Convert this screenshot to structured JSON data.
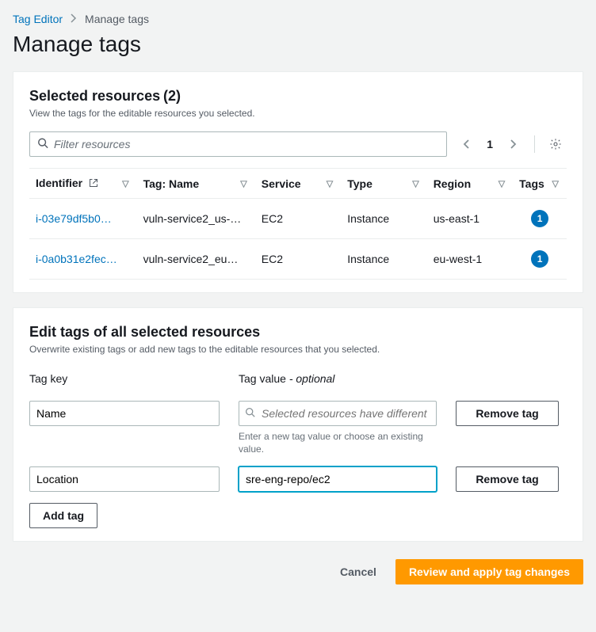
{
  "breadcrumb": {
    "root": "Tag Editor",
    "current": "Manage tags"
  },
  "page_title": "Manage tags",
  "selected_panel": {
    "title": "Selected resources",
    "count": "(2)",
    "subtitle": "View the tags for the editable resources you selected.",
    "filter_placeholder": "Filter resources",
    "page_number": "1",
    "columns": {
      "identifier": "Identifier",
      "tag_name": "Tag: Name",
      "service": "Service",
      "type": "Type",
      "region": "Region",
      "tags": "Tags"
    },
    "rows": [
      {
        "identifier": "i-03e79df5b0…",
        "tag_name": "vuln-service2_us-…",
        "service": "EC2",
        "type": "Instance",
        "region": "us-east-1",
        "tags": "1"
      },
      {
        "identifier": "i-0a0b31e2fec…",
        "tag_name": "vuln-service2_eu…",
        "service": "EC2",
        "type": "Instance",
        "region": "eu-west-1",
        "tags": "1"
      }
    ]
  },
  "edit_panel": {
    "title": "Edit tags of all selected resources",
    "subtitle": "Overwrite existing tags or add new tags to the editable resources that you selected.",
    "labels": {
      "tag_key": "Tag key",
      "tag_value": "Tag value",
      "optional": " - optional"
    },
    "value_placeholder": "Selected resources have different tag values",
    "value_help": "Enter a new tag value or choose an existing value.",
    "remove_tag": "Remove tag",
    "add_tag": "Add tag",
    "rows": [
      {
        "key": "Name",
        "value": ""
      },
      {
        "key": "Location",
        "value": "sre-eng-repo/ec2"
      }
    ]
  },
  "footer": {
    "cancel": "Cancel",
    "apply": "Review and apply tag changes"
  }
}
